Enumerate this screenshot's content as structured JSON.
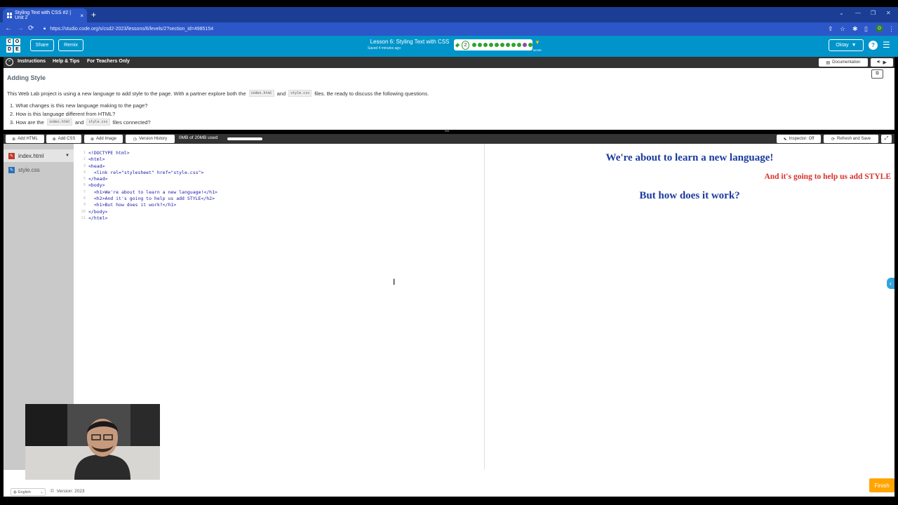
{
  "browser": {
    "tab_title": "Styling Text with CSS #2 | Unit 2",
    "tab_close": "×",
    "new_tab": "+",
    "url": "https://studio.code.org/s/csd2-2023/lessons/6/levels/2?section_id=4985154",
    "window_controls": [
      "⌄",
      "—",
      "❐",
      "✕"
    ],
    "profile_initial": "O"
  },
  "header": {
    "logo_letters": [
      "C",
      "O",
      "D",
      "E"
    ],
    "share_label": "Share",
    "remix_label": "Remix",
    "lesson_title": "Lesson 6: Styling Text with CSS",
    "saved_text": "Saved 4 minutes ago",
    "current_level": "2",
    "level_dots": [
      "#2fa32f",
      "#2fa32f",
      "#2fa32f",
      "#2fa32f",
      "#2fa32f",
      "#2fa32f",
      "#2fa32f",
      "#2fa32f",
      "#2fa32f",
      "#8a4fa8",
      "#2fa32f"
    ],
    "more_label": "MORE",
    "user_name": "Oktay",
    "help_label": "?"
  },
  "instructions_bar": {
    "tabs": [
      "Instructions",
      "Help & Tips",
      "For Teachers Only"
    ],
    "documentation_label": "Documentation"
  },
  "instructions": {
    "title": "Adding Style",
    "intro_before": "This Web Lab project is using a new language to add style to the page. With a partner explore both the",
    "file1": "index.html",
    "and": "and",
    "file2": "style.css",
    "intro_after": "files. Be ready to discuss the following questions.",
    "q1": "1. What changes is this new language making to the page?",
    "q2": "2. How is this language different from HTML?",
    "q3_before": "3. How are the",
    "q3_after": "files connected?"
  },
  "editor_toolbar": {
    "add_html": "Add HTML",
    "add_css": "Add CSS",
    "add_image": "Add Image",
    "version_history": "Version History",
    "usage": "0MB of 20MB used",
    "inspector": "Inspector: Off",
    "refresh": "Refresh and Save"
  },
  "files": [
    {
      "name": "index.html",
      "active": true
    },
    {
      "name": "style.css",
      "active": false
    }
  ],
  "code": {
    "line_numbers": [
      "1",
      "2",
      "3",
      "4",
      "5",
      "6",
      "7",
      "8",
      "9",
      "10",
      "11"
    ],
    "lines": [
      "<!DOCTYPE html>",
      "<html>",
      "<head>",
      "  <link rel=\"stylesheet\" href=\"style.css\">",
      "</head>",
      "<body>",
      "  <h1>We're about to learn a new language!</h1>",
      "  <h2>And it's going to help us add STYLE</h2>",
      "  <h1>But how does it work?</h1>",
      "</body>",
      "</html>"
    ]
  },
  "preview": {
    "h1_first": "We're about to learn a new language!",
    "h2": "And it's going to help us add STYLE",
    "h1_second": "But how does it work?"
  },
  "footer": {
    "language": "English",
    "version": "Version: 2023",
    "finish_label": "Finish"
  },
  "colors": {
    "brand": "#0094ca",
    "finish": "#ffa400",
    "preview_h1": "#1a3aa0",
    "preview_h2": "#d9302c"
  }
}
